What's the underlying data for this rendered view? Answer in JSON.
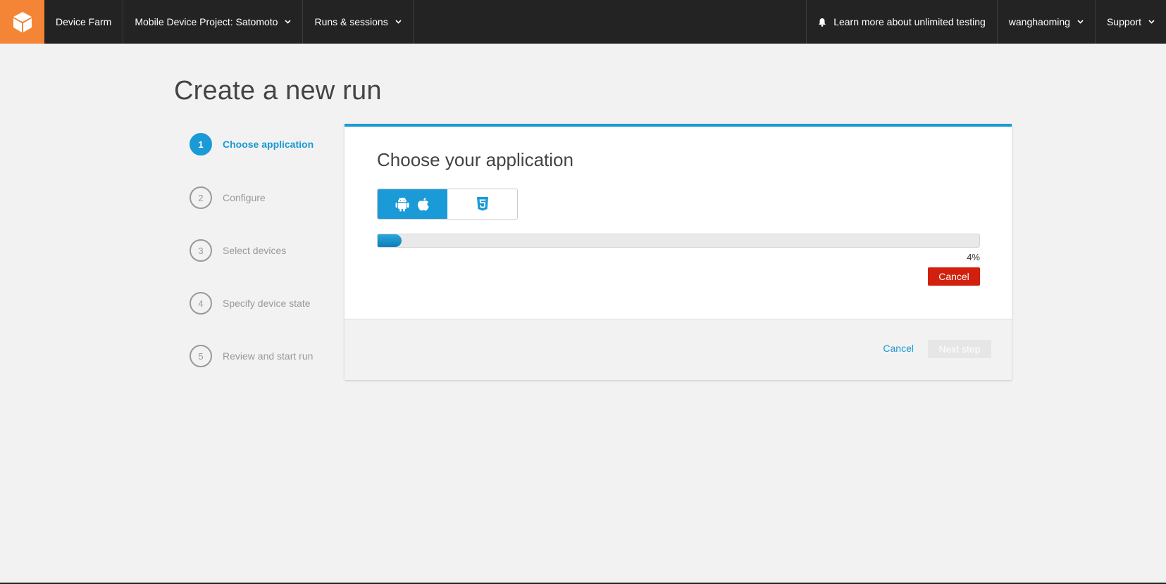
{
  "nav": {
    "logo_icon": "cube-icon",
    "service_name": "Device Farm",
    "project_label": "Mobile Device Project: Satomoto",
    "runs_label": "Runs & sessions",
    "learn_more_label": "Learn more about unlimited testing",
    "user_label": "wanghaoming",
    "support_label": "Support"
  },
  "page": {
    "title": "Create a new run"
  },
  "steps": [
    {
      "number": "1",
      "label": "Choose application",
      "active": true
    },
    {
      "number": "2",
      "label": "Configure",
      "active": false
    },
    {
      "number": "3",
      "label": "Select devices",
      "active": false
    },
    {
      "number": "4",
      "label": "Specify device state",
      "active": false
    },
    {
      "number": "5",
      "label": "Review and start run",
      "active": false
    }
  ],
  "panel": {
    "heading": "Choose your application",
    "platform_toggle": {
      "native": {
        "icons": [
          "android-icon",
          "apple-icon"
        ],
        "selected": true
      },
      "web": {
        "icons": [
          "html5-icon"
        ],
        "selected": false
      }
    },
    "upload": {
      "progress": 4,
      "progress_text": "4%",
      "cancel_label": "Cancel"
    },
    "footer": {
      "cancel_label": "Cancel",
      "next_label": "Next step"
    }
  },
  "colors": {
    "accent": "#1a9ad6",
    "nav_bg": "#232323",
    "logo_bg": "#f58536",
    "danger": "#d1210e"
  }
}
